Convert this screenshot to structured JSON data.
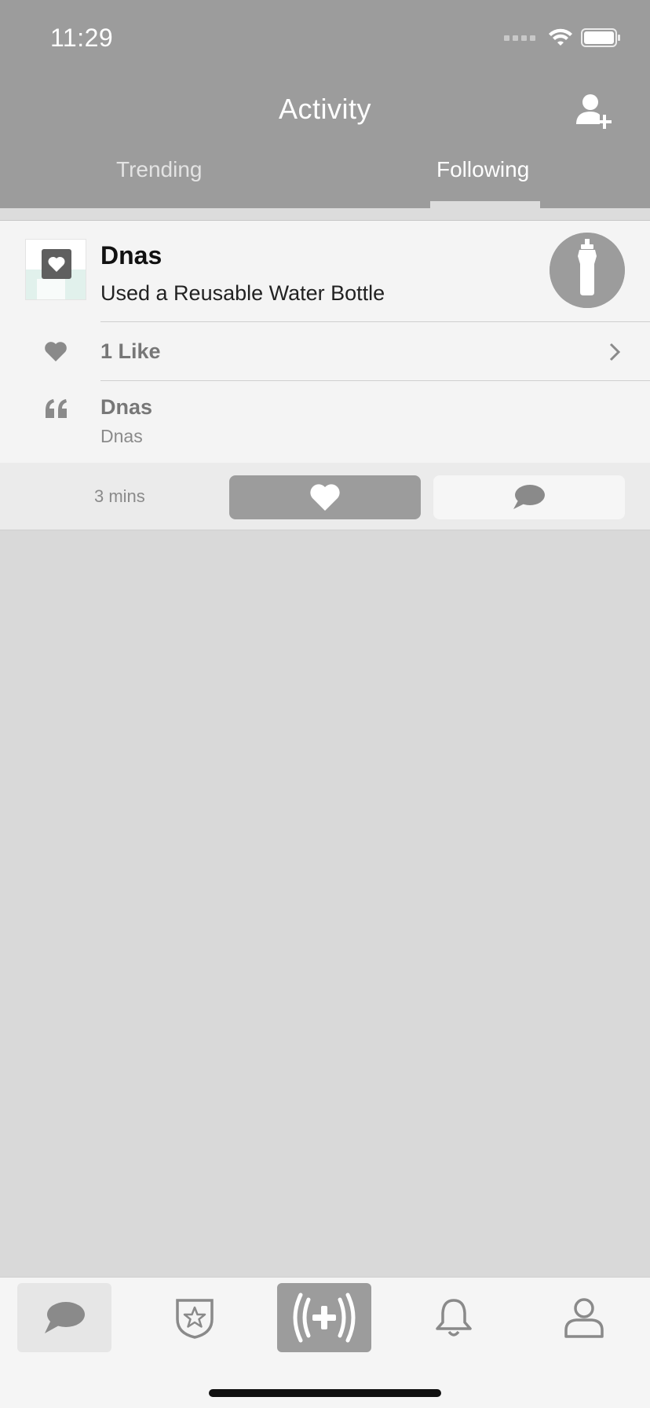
{
  "status_bar": {
    "time": "11:29"
  },
  "header": {
    "title": "Activity",
    "add_friend_icon": "person-plus-icon",
    "tabs": [
      {
        "label": "Trending",
        "active": false
      },
      {
        "label": "Following",
        "active": true
      }
    ]
  },
  "activity": {
    "user_name": "Dnas",
    "action": "Used a Reusable Water Bottle",
    "action_icon": "water-bottle-icon",
    "likes_label": "1 Like",
    "comment": {
      "author": "Dnas",
      "text": "Dnas"
    },
    "time_ago": "3 mins"
  },
  "tabbar": {
    "items": [
      {
        "name": "feed",
        "icon": "chat-bubble-icon",
        "active": true
      },
      {
        "name": "badges",
        "icon": "star-shield-icon",
        "active": false
      },
      {
        "name": "log-action",
        "icon": "plus-broadcast-icon",
        "active": false
      },
      {
        "name": "notifications",
        "icon": "bell-icon",
        "active": false
      },
      {
        "name": "profile",
        "icon": "person-icon",
        "active": false
      }
    ]
  },
  "colors": {
    "header_bg": "#9c9c9c",
    "page_bg": "#d9d9d9",
    "card_bg": "#f4f4f4",
    "accent": "#9c9c9c"
  }
}
